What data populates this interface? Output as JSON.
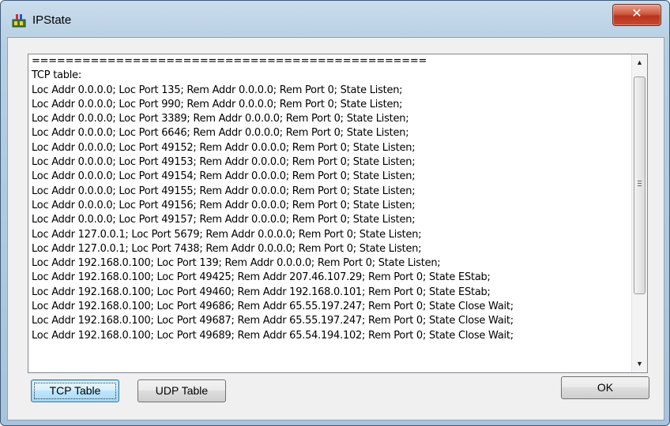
{
  "window": {
    "title": "IPState",
    "close_glyph": "✕"
  },
  "listbox": {
    "lines": [
      "===============================================",
      "TCP table:",
      "Loc Addr 0.0.0.0; Loc Port 135; Rem Addr 0.0.0.0; Rem Port 0; State Listen;",
      "Loc Addr 0.0.0.0; Loc Port 990; Rem Addr 0.0.0.0; Rem Port 0; State Listen;",
      "Loc Addr 0.0.0.0; Loc Port 3389; Rem Addr 0.0.0.0; Rem Port 0; State Listen;",
      "Loc Addr 0.0.0.0; Loc Port 6646; Rem Addr 0.0.0.0; Rem Port 0; State Listen;",
      "Loc Addr 0.0.0.0; Loc Port 49152; Rem Addr 0.0.0.0; Rem Port 0; State Listen;",
      "Loc Addr 0.0.0.0; Loc Port 49153; Rem Addr 0.0.0.0; Rem Port 0; State Listen;",
      "Loc Addr 0.0.0.0; Loc Port 49154; Rem Addr 0.0.0.0; Rem Port 0; State Listen;",
      "Loc Addr 0.0.0.0; Loc Port 49155; Rem Addr 0.0.0.0; Rem Port 0; State Listen;",
      "Loc Addr 0.0.0.0; Loc Port 49156; Rem Addr 0.0.0.0; Rem Port 0; State Listen;",
      "Loc Addr 0.0.0.0; Loc Port 49157; Rem Addr 0.0.0.0; Rem Port 0; State Listen;",
      "Loc Addr 127.0.0.1; Loc Port 5679; Rem Addr 0.0.0.0; Rem Port 0; State Listen;",
      "Loc Addr 127.0.0.1; Loc Port 7438; Rem Addr 0.0.0.0; Rem Port 0; State Listen;",
      "Loc Addr 192.168.0.100; Loc Port 139; Rem Addr 0.0.0.0; Rem Port 0; State Listen;",
      "Loc Addr 192.168.0.100; Loc Port 49425; Rem Addr 207.46.107.29; Rem Port 0; State EStab;",
      "Loc Addr 192.168.0.100; Loc Port 49460; Rem Addr 192.168.0.101; Rem Port 0; State EStab;",
      "Loc Addr 192.168.0.100; Loc Port 49686; Rem Addr 65.55.197.247; Rem Port 0; State Close Wait;",
      "Loc Addr 192.168.0.100; Loc Port 49687; Rem Addr 65.55.197.247; Rem Port 0; State Close Wait;",
      "Loc Addr 192.168.0.100; Loc Port 49689; Rem Addr 65.54.194.102; Rem Port 0; State Close Wait;"
    ]
  },
  "scrollbar": {
    "up_glyph": "▲",
    "down_glyph": "▼"
  },
  "buttons": {
    "tcp": "TCP Table",
    "udp": "UDP Table",
    "ok": "OK"
  }
}
